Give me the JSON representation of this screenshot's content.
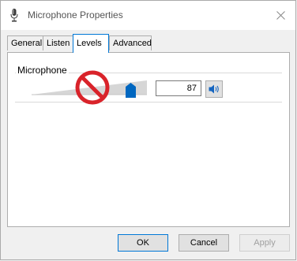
{
  "window": {
    "title": "Microphone Properties"
  },
  "tabs": [
    {
      "label": "General"
    },
    {
      "label": "Listen"
    },
    {
      "label": "Levels"
    },
    {
      "label": "Advanced"
    }
  ],
  "levels": {
    "group_label": "Microphone",
    "volume_value": "87"
  },
  "buttons": {
    "ok": "OK",
    "cancel": "Cancel",
    "apply": "Apply"
  },
  "icons": {
    "title": "microphone-icon",
    "close": "close-icon",
    "speaker": "speaker-icon",
    "prohibited": "no-entry-icon"
  },
  "colors": {
    "accent": "#0078d7",
    "prohibited": "#d9232a"
  }
}
